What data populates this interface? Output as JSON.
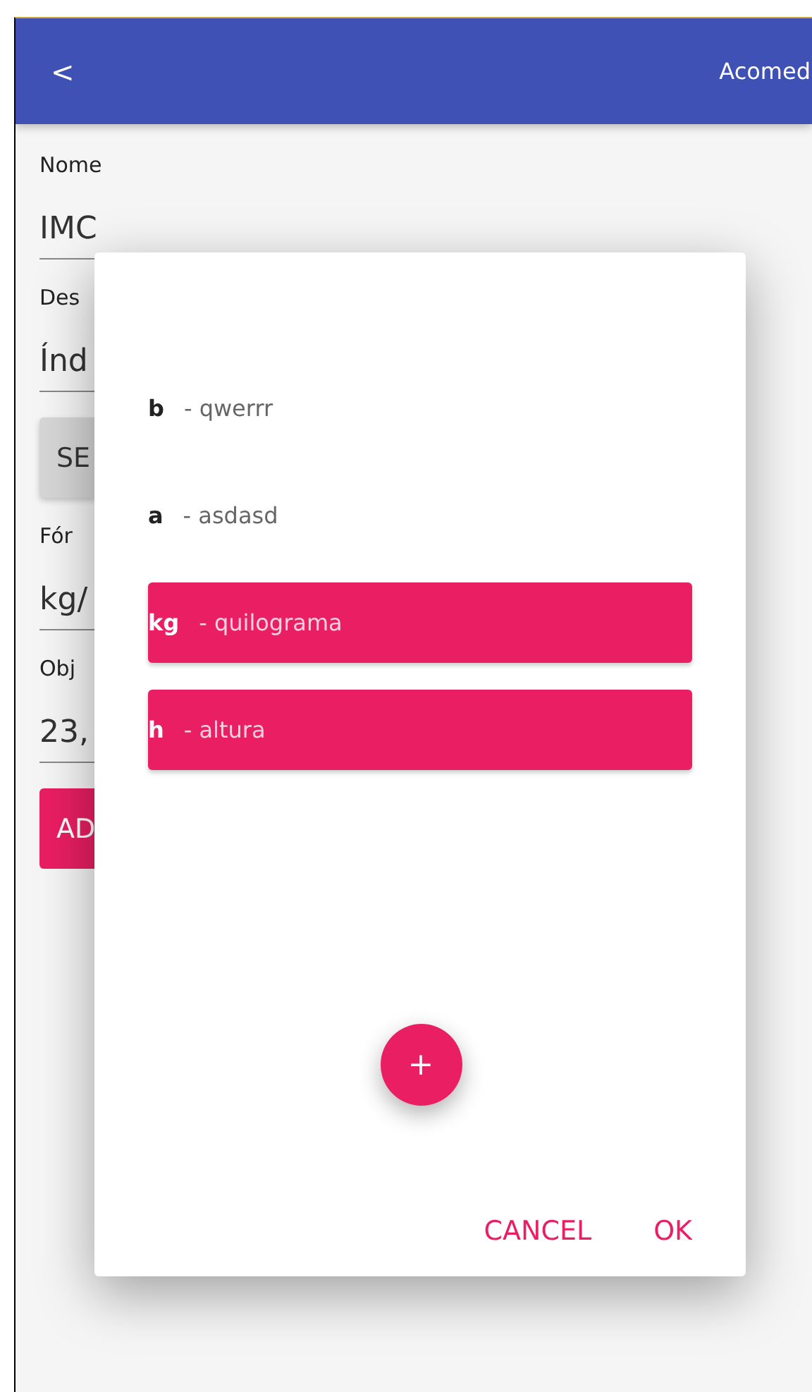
{
  "header": {
    "back": "<",
    "title": "Acomed"
  },
  "form": [
    {
      "kind": "field",
      "label": "Nome",
      "value": "IMC"
    },
    {
      "kind": "field",
      "label": "Des",
      "value": "Índ"
    },
    {
      "kind": "button",
      "label": "SE"
    },
    {
      "kind": "field",
      "label": "Fór",
      "value": "kg/"
    },
    {
      "kind": "field",
      "label": "Obj",
      "value": "23,"
    },
    {
      "kind": "accent_button",
      "label": "AD"
    }
  ],
  "dialog": {
    "items": [
      {
        "key": "b",
        "description": "- qwerrr",
        "selected": false
      },
      {
        "key": "a",
        "description": "- asdasd",
        "selected": false
      },
      {
        "key": "kg",
        "description": "- quilograma",
        "selected": true
      },
      {
        "key": "h",
        "description": "- altura",
        "selected": true
      }
    ],
    "add_button": "+",
    "actions": [
      "CANCEL",
      "OK"
    ]
  }
}
